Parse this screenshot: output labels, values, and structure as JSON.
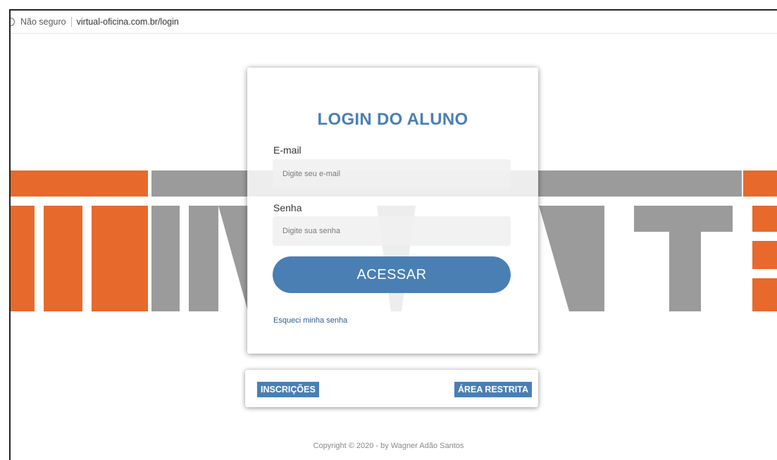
{
  "browser": {
    "security_label": "Não seguro",
    "url": "virtual-oficina.com.br/login"
  },
  "background": {
    "logo_text": "REINVENTE",
    "colors": {
      "orange": "#E8692C",
      "gray": "#9B9B9B"
    }
  },
  "login": {
    "title": "LOGIN DO ALUNO",
    "email_label": "E-mail",
    "email_placeholder": "Digite seu e-mail",
    "password_label": "Senha",
    "password_placeholder": "Digite sua senha",
    "submit_label": "ACESSAR",
    "forgot_label": "Esqueci minha senha"
  },
  "links": {
    "inscricoes_label": "INSCRIÇÕES",
    "area_restrita_label": "ÁREA RESTRITA"
  },
  "footer": {
    "text": "Copyright © 2020 - by Wagner Adão Santos"
  },
  "theme": {
    "accent": "#4A7FB4"
  }
}
